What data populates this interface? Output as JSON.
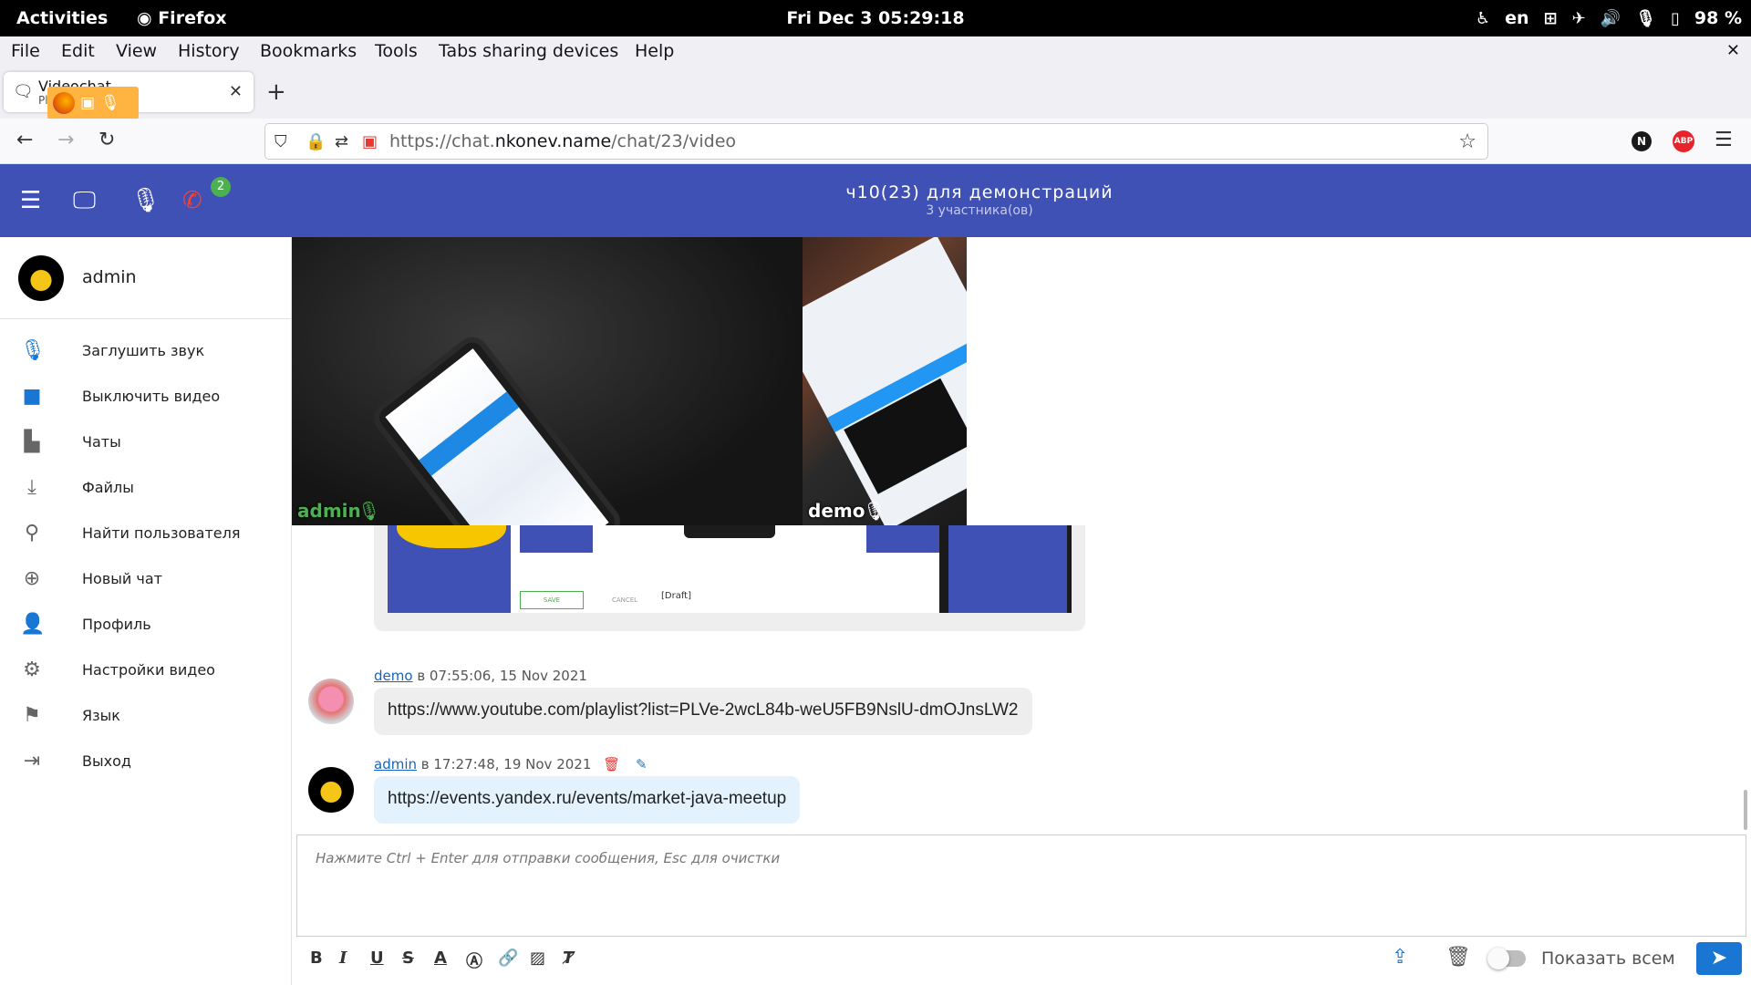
{
  "gnome": {
    "activities": "Activities",
    "app_name": "Firefox",
    "datetime": "Fri Dec 3  05:29:18",
    "lang": "en",
    "battery": "98 %"
  },
  "menu": {
    "file": "File",
    "edit": "Edit",
    "view": "View",
    "history": "History",
    "bookmarks": "Bookmarks",
    "tools": "Tools",
    "tabs_sharing": "Tabs sharing devices",
    "help": "Help"
  },
  "tab": {
    "title": "Videochat",
    "subtitle": "Pl"
  },
  "nav": {
    "url_prefix": "https://chat.",
    "url_domain": "nkonev.name",
    "url_path": "/chat/23/video",
    "ext_n": "N",
    "ext_abp": "ABP"
  },
  "header": {
    "title": "ч10(23) для демонстраций",
    "subtitle": "3 участника(ов)",
    "call_badge": "2"
  },
  "sidebar": {
    "username": "admin",
    "items": [
      {
        "label": "Заглушить звук"
      },
      {
        "label": "Выключить видео"
      },
      {
        "label": "Чаты"
      },
      {
        "label": "Файлы"
      },
      {
        "label": "Найти пользователя"
      },
      {
        "label": "Новый чат"
      },
      {
        "label": "Профиль"
      },
      {
        "label": "Настройки видео"
      },
      {
        "label": "Язык"
      },
      {
        "label": "Выход"
      }
    ]
  },
  "videos": {
    "local_name": "admin",
    "remote_name": "demo"
  },
  "image_message": {
    "save": "SAVE",
    "cancel": "CANCEL",
    "draft": "[Draft]"
  },
  "messages": [
    {
      "author": "demo",
      "time": "в 07:55:06, 15 Nov 2021",
      "text": "https://www.youtube.com/playlist?list=PLVe-2wcL84b-weU5FB9NslU-dmOJnsLW2"
    },
    {
      "author": "admin",
      "time": "в 17:27:48, 19 Nov 2021",
      "text": "https://events.yandex.ru/events/market-java-meetup"
    }
  ],
  "editor": {
    "placeholder": "Нажмите Ctrl + Enter для отправки сообщения, Esc для очистки",
    "show_all_label": "Показать всем"
  },
  "colors": {
    "app_bar": "#3f51b5",
    "accent": "#1976d2",
    "call_end": "#f44336",
    "badge": "#4caf50"
  }
}
